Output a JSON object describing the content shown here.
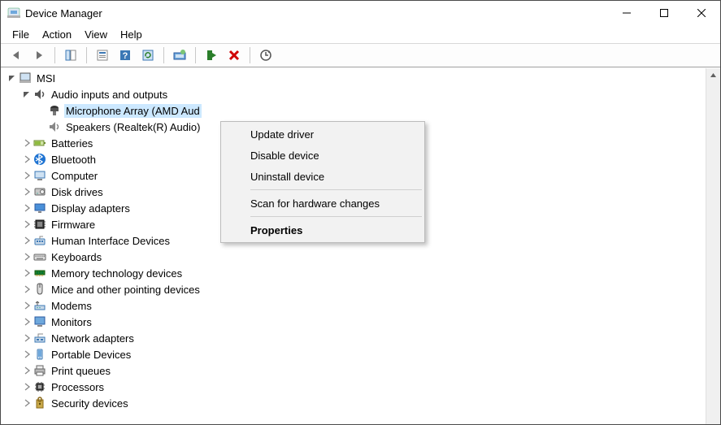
{
  "window": {
    "title": "Device Manager"
  },
  "menubar": [
    "File",
    "Action",
    "View",
    "Help"
  ],
  "toolbar_icons": [
    "back",
    "forward",
    "sep",
    "show-hide-tree",
    "sep",
    "properties-small",
    "help",
    "refresh",
    "sep",
    "update-driver-tool",
    "sep",
    "enable-device",
    "disable-device",
    "sep",
    "uninstall-tool"
  ],
  "tree": {
    "root": {
      "label": "MSI",
      "expanded": true
    },
    "audio": {
      "label": "Audio inputs and outputs",
      "expanded": true,
      "children": [
        {
          "label": "Microphone Array (AMD Aud",
          "selected": true
        },
        {
          "label": "Speakers (Realtek(R) Audio)"
        }
      ]
    },
    "categories": [
      {
        "label": "Batteries",
        "icon": "battery"
      },
      {
        "label": "Bluetooth",
        "icon": "bluetooth"
      },
      {
        "label": "Computer",
        "icon": "computer"
      },
      {
        "label": "Disk drives",
        "icon": "disk"
      },
      {
        "label": "Display adapters",
        "icon": "display"
      },
      {
        "label": "Firmware",
        "icon": "firmware"
      },
      {
        "label": "Human Interface Devices",
        "icon": "hid"
      },
      {
        "label": "Keyboards",
        "icon": "keyboard"
      },
      {
        "label": "Memory technology devices",
        "icon": "memory"
      },
      {
        "label": "Mice and other pointing devices",
        "icon": "mouse"
      },
      {
        "label": "Modems",
        "icon": "modem"
      },
      {
        "label": "Monitors",
        "icon": "monitor"
      },
      {
        "label": "Network adapters",
        "icon": "network"
      },
      {
        "label": "Portable Devices",
        "icon": "portable"
      },
      {
        "label": "Print queues",
        "icon": "printer"
      },
      {
        "label": "Processors",
        "icon": "cpu"
      },
      {
        "label": "Security devices",
        "icon": "security"
      }
    ]
  },
  "context_menu": {
    "items": [
      {
        "label": "Update driver"
      },
      {
        "label": "Disable device"
      },
      {
        "label": "Uninstall device"
      },
      "sep",
      {
        "label": "Scan for hardware changes"
      },
      "sep",
      {
        "label": "Properties",
        "default": true
      }
    ]
  }
}
